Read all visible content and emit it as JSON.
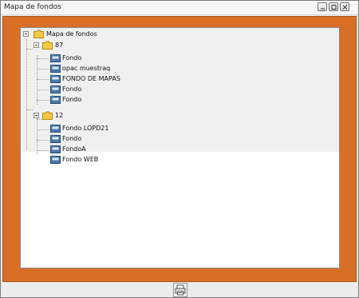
{
  "window": {
    "title": "Mapa de fondos"
  },
  "tree": {
    "root": {
      "label": "Mapa de fondos"
    },
    "groups": [
      {
        "label": "87",
        "items": [
          {
            "label": "Fondo"
          },
          {
            "label": "opac muestraq"
          },
          {
            "label": "FONDO DE MAPAS"
          },
          {
            "label": "Fondo"
          },
          {
            "label": "Fondo"
          }
        ]
      },
      {
        "label": "12",
        "items": [
          {
            "label": "Fondo LOPD21"
          },
          {
            "label": "Fondo"
          },
          {
            "label": "FondoA"
          },
          {
            "label": "Fondo WEB"
          }
        ]
      }
    ]
  },
  "colors": {
    "frame": "#d96f27",
    "tree_bg": "#f0f0f0",
    "folder_yellow": "#f5c842",
    "database_blue": "#4d79a8"
  },
  "icons": {
    "window_minimize": "minimize-icon",
    "window_maximize": "maximize-icon",
    "window_close": "close-icon",
    "folder": "folder-icon",
    "database": "database-icon",
    "footer": "print-icon"
  }
}
